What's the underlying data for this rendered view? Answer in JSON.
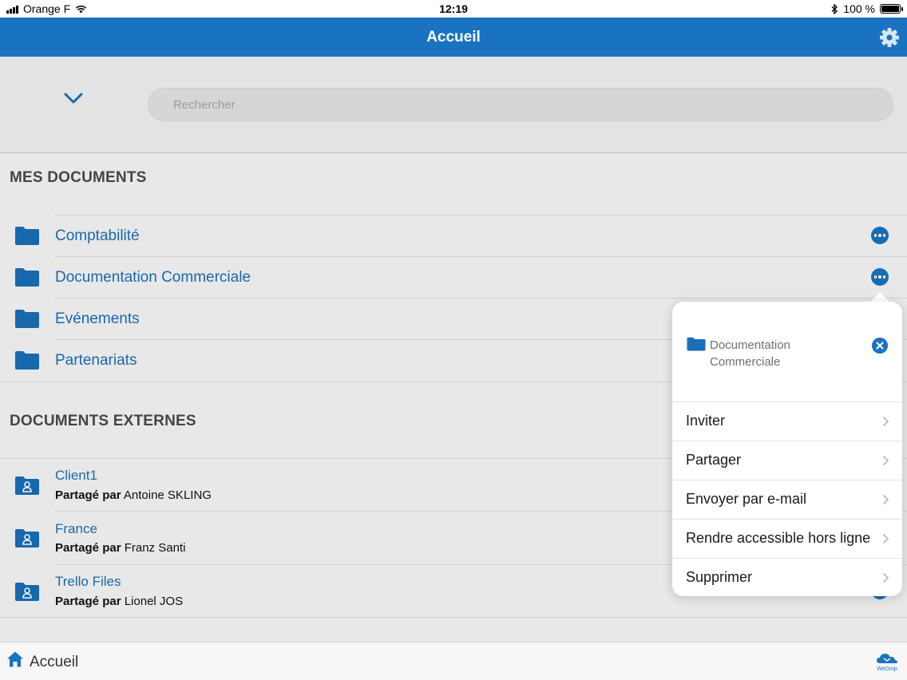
{
  "status_bar": {
    "carrier": "Orange F",
    "time": "12:19",
    "battery": "100 %"
  },
  "nav": {
    "title": "Accueil"
  },
  "search": {
    "placeholder": "Rechercher"
  },
  "my_documents": {
    "title": "MES DOCUMENTS",
    "items": [
      {
        "label": "Comptabilité"
      },
      {
        "label": "Documentation Commerciale"
      },
      {
        "label": "Evénements"
      },
      {
        "label": "Partenariats"
      }
    ]
  },
  "external_documents": {
    "title": "DOCUMENTS EXTERNES",
    "shared_by_label": "Partagé par",
    "items": [
      {
        "name": "Client1",
        "owner": "Antoine SKLING"
      },
      {
        "name": "France",
        "owner": "Franz Santi"
      },
      {
        "name": "Trello Files",
        "owner": "Lionel JOS"
      }
    ]
  },
  "popover": {
    "title_line1": "Documentation",
    "title_line2": "Commerciale",
    "actions": [
      {
        "label": "Inviter"
      },
      {
        "label": "Partager"
      },
      {
        "label": "Envoyer par e-mail"
      },
      {
        "label": "Rendre accessible hors ligne"
      },
      {
        "label": "Supprimer"
      }
    ]
  },
  "bottom_bar": {
    "home_label": "Accueil",
    "logo_text": "WeDrop"
  },
  "colors": {
    "accent": "#1a73c0",
    "link": "#1c6fb6",
    "section_title": "#4a4a4a"
  }
}
